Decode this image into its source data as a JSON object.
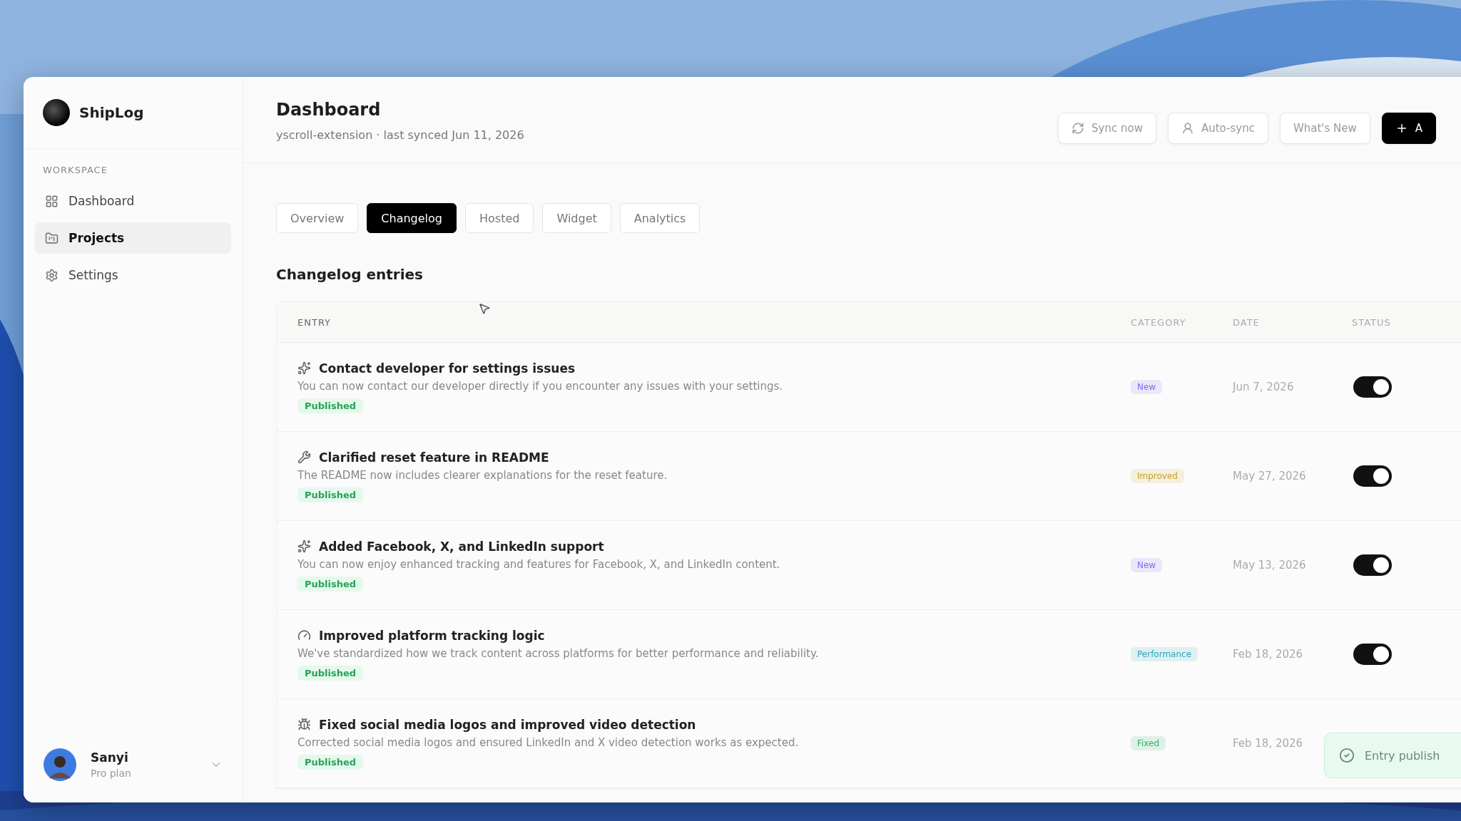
{
  "app": {
    "name": "ShipLog"
  },
  "sidebar": {
    "section": "WORKSPACE",
    "items": [
      {
        "label": "Dashboard",
        "selected": false
      },
      {
        "label": "Projects",
        "selected": true
      },
      {
        "label": "Settings",
        "selected": false
      }
    ]
  },
  "user": {
    "name": "Sanyi",
    "plan": "Pro plan"
  },
  "header": {
    "title": "Dashboard",
    "subtitle": "yscroll-extension · last synced Jun 11, 2026",
    "actions": [
      {
        "label": "Sync now",
        "kind": "sync"
      },
      {
        "label": "Auto-sync",
        "kind": "auto"
      },
      {
        "label": "What's New",
        "kind": "plain"
      },
      {
        "label": "A",
        "kind": "primary"
      }
    ]
  },
  "tabs": [
    {
      "label": "Overview",
      "selected": false
    },
    {
      "label": "Changelog",
      "selected": true
    },
    {
      "label": "Hosted",
      "selected": false
    },
    {
      "label": "Widget",
      "selected": false
    },
    {
      "label": "Analytics",
      "selected": false
    }
  ],
  "section_title": "Changelog entries",
  "table": {
    "columns": [
      "ENTRY",
      "CATEGORY",
      "DATE",
      "STATUS"
    ],
    "rows": [
      {
        "kind": "new",
        "title": "Contact developer for settings issues",
        "description": "You can now contact our developer directly if you encounter any issues with your settings.",
        "status": "Published",
        "category": "New",
        "color": "#7c6cf0",
        "date": "Jun 7, 2026",
        "on": true
      },
      {
        "kind": "improved",
        "title": "Clarified reset feature in README",
        "description": "The README now includes clearer explanations for the reset feature.",
        "status": "Published",
        "category": "Improved",
        "color": "#c9a227",
        "date": "May 27, 2026",
        "on": true
      },
      {
        "kind": "new",
        "title": "Added Facebook, X, and LinkedIn support",
        "description": "You can now enjoy enhanced tracking and features for Facebook, X, and LinkedIn content.",
        "status": "Published",
        "category": "New",
        "color": "#7c6cf0",
        "date": "May 13, 2026",
        "on": true
      },
      {
        "kind": "performance",
        "title": "Improved platform tracking logic",
        "description": "We've standardized how we track content across platforms for better performance and reliability.",
        "status": "Published",
        "category": "Performance",
        "color": "#2aa7b8",
        "date": "Feb 18, 2026",
        "on": true
      },
      {
        "kind": "fixed",
        "title": "Fixed social media logos and improved video detection",
        "description": "Corrected social media logos and ensured LinkedIn and X video detection works as expected.",
        "status": "Published",
        "category": "Fixed",
        "color": "#2fb36a",
        "date": "Feb 18, 2026"
      }
    ]
  },
  "toast": {
    "message": "Entry publish"
  }
}
